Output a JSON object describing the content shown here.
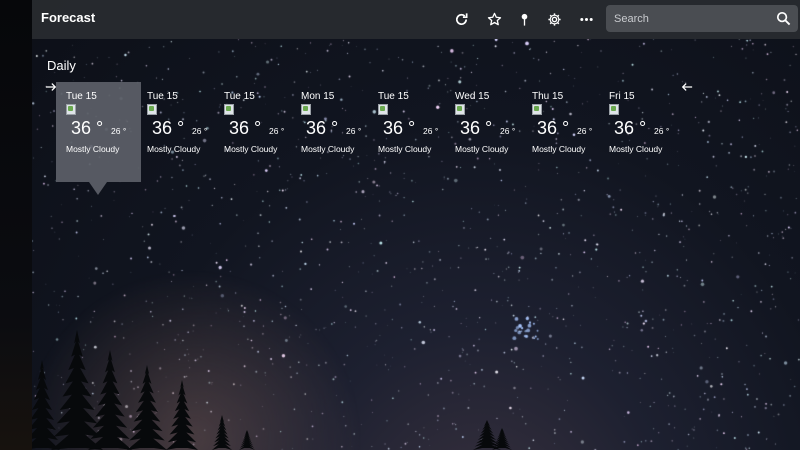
{
  "app": {
    "title": "Forecast"
  },
  "header": {
    "icons": [
      "refresh-icon",
      "star-icon",
      "pin-icon",
      "gear-icon",
      "more-icon"
    ],
    "search": {
      "placeholder": "Search",
      "value": ""
    }
  },
  "section": {
    "title": "Daily"
  },
  "days": [
    {
      "day": "Tue 15",
      "high": "36 °",
      "low": "26 °",
      "condition": "Mostly Cloudy",
      "selected": true
    },
    {
      "day": "Tue 15",
      "high": "36 °",
      "low": "26 °",
      "condition": "Mostly Cloudy"
    },
    {
      "day": "Tue 15",
      "high": "36 °",
      "low": "26 °",
      "condition": "Mostly Cloudy"
    },
    {
      "day": "Mon 15",
      "high": "36 °",
      "low": "26 °",
      "condition": "Mostly Cloudy"
    },
    {
      "day": "Tue 15",
      "high": "36 °",
      "low": "26 °",
      "condition": "Mostly Cloudy"
    },
    {
      "day": "Wed 15",
      "high": "36 °",
      "low": "26 °",
      "condition": "Mostly Cloudy"
    },
    {
      "day": "Thu 15",
      "high": "36 °",
      "low": "26 °",
      "condition": "Mostly Cloudy"
    },
    {
      "day": "Fri 15",
      "high": "36 °",
      "low": "26 °",
      "condition": "Mostly Cloudy"
    }
  ]
}
